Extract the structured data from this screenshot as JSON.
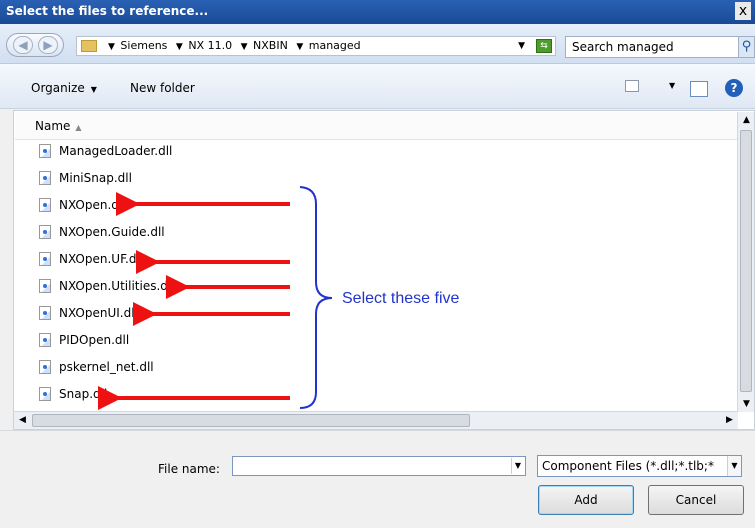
{
  "window": {
    "title": "Select the files to reference...",
    "close_glyph": "x"
  },
  "address": {
    "crumbs": [
      "Siemens",
      "NX 11.0",
      "NXBIN",
      "managed"
    ],
    "search_placeholder": "Search managed"
  },
  "toolbar": {
    "organize_label": "Organize",
    "new_folder_label": "New folder",
    "help_glyph": "?"
  },
  "filelist": {
    "column_name": "Name",
    "files": [
      "ManagedLoader.dll",
      "MiniSnap.dll",
      "NXOpen.dll",
      "NXOpen.Guide.dll",
      "NXOpen.UF.dll",
      "NXOpen.Utilities.dll",
      "NXOpenUI.dll",
      "PIDOpen.dll",
      "pskernel_net.dll",
      "Snap.dll"
    ]
  },
  "annotation": {
    "text": "Select these five",
    "arrow_color": "#ee1111",
    "brace_color": "#2233cc",
    "text_color": "#2233cc"
  },
  "bottom": {
    "file_name_label": "File name:",
    "file_name_value": "",
    "filter_value": "Component Files (*.dll;*.tlb;*",
    "add_label": "Add",
    "cancel_label": "Cancel"
  }
}
